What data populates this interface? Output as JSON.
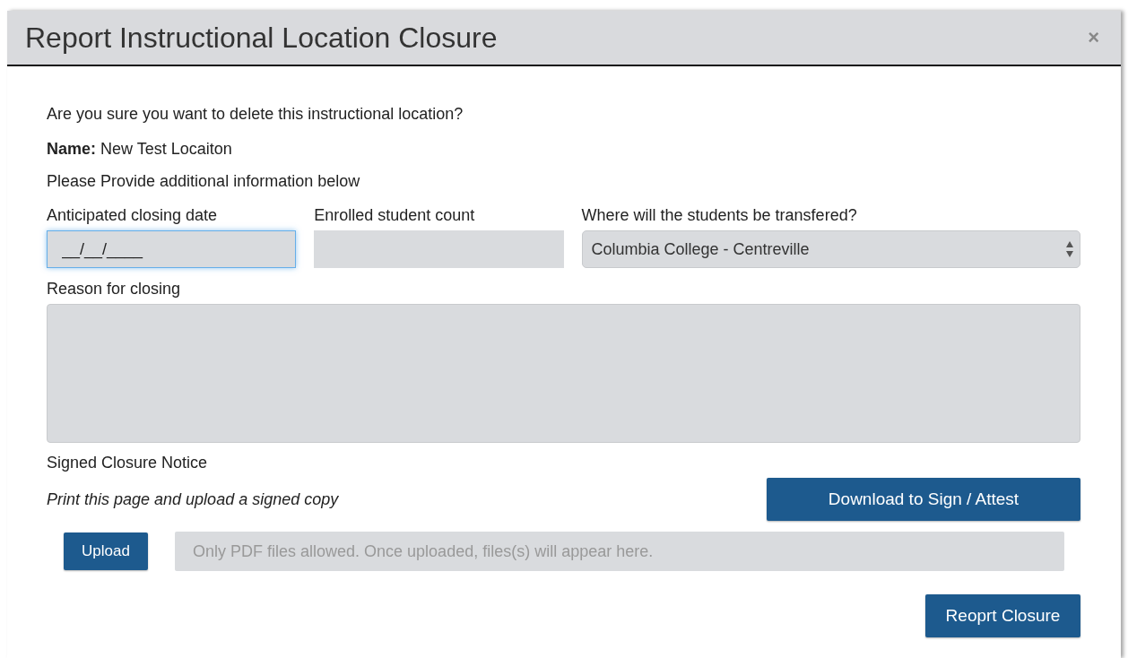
{
  "dialog": {
    "title": "Report Instructional Location Closure",
    "close_label": "×"
  },
  "question": "Are you sure you want to delete this instructional location?",
  "name_line": "**Name:** New Test Locaiton",
  "instructions": "Please Provide additional information below",
  "fields": [
    {
      "label": "Anticipated closing date",
      "kind": "input",
      "value": "__/__/____",
      "focused": true
    },
    {
      "label": "Enrolled student count",
      "kind": "input",
      "focused": false
    },
    {
      "label": "Where will the students be transfered?",
      "kind": "select",
      "value": "Columbia College - Centreville",
      "focused": false
    }
  ],
  "reason": {
    "label": "Reason for closing"
  },
  "notice": {
    "label": "Signed Closure Notice",
    "hint": "Print this page and upload a signed copy",
    "download_button": "Download to Sign / Attest",
    "upload_button": "Upload",
    "files_placeholder": "Only PDF files allowed. Once uploaded, files(s) will appear here."
  },
  "submit_button": "Reoprt Closure"
}
